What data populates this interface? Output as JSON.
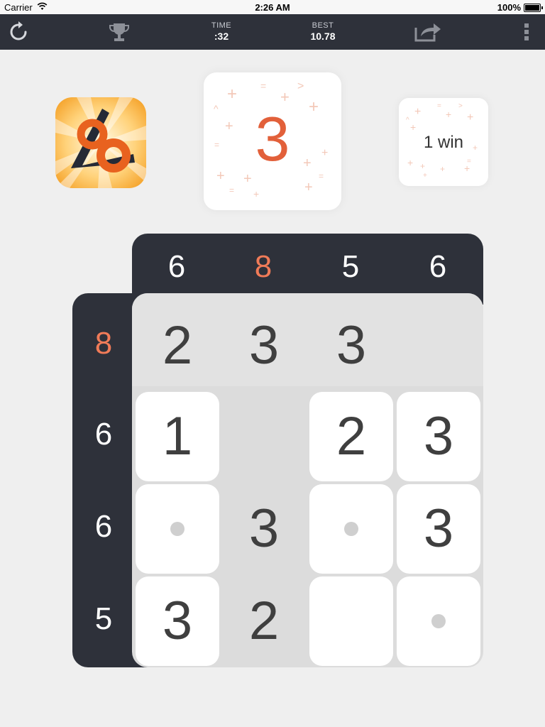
{
  "status_bar": {
    "carrier": "Carrier",
    "time": "2:26 AM",
    "battery": "100%"
  },
  "toolbar": {
    "time_label": "TIME",
    "time_value": ":32",
    "best_label": "BEST",
    "best_value": "10.78",
    "icons": [
      "refresh-icon",
      "trophy-icon",
      "share-icon",
      "more-icon"
    ]
  },
  "target": {
    "value": "3"
  },
  "wins": {
    "text": "1 win"
  },
  "colors": {
    "accent": "#e2603a",
    "header_accent": "#f07b58",
    "dark": "#2e313a",
    "board": "#dcdcdc"
  },
  "board": {
    "column_sums": [
      "6",
      "8",
      "5",
      "6"
    ],
    "highlighted_column": 1,
    "row_sums": [
      "8",
      "6",
      "6",
      "5"
    ],
    "highlighted_row": 0,
    "rows": [
      [
        {
          "kind": "fixed",
          "v": "2"
        },
        {
          "kind": "fixed",
          "v": "3"
        },
        {
          "kind": "fixed",
          "v": "3"
        },
        {
          "kind": "empty",
          "v": ""
        }
      ],
      [
        {
          "kind": "tile",
          "v": "1"
        },
        {
          "kind": "empty",
          "v": ""
        },
        {
          "kind": "tile",
          "v": "2"
        },
        {
          "kind": "tile",
          "v": "3"
        }
      ],
      [
        {
          "kind": "dot",
          "v": ""
        },
        {
          "kind": "fixed",
          "v": "3"
        },
        {
          "kind": "dot",
          "v": ""
        },
        {
          "kind": "tile",
          "v": "3"
        }
      ],
      [
        {
          "kind": "tile",
          "v": "3"
        },
        {
          "kind": "fixed",
          "v": "2"
        },
        {
          "kind": "tile",
          "v": ""
        },
        {
          "kind": "dot",
          "v": ""
        }
      ]
    ]
  }
}
